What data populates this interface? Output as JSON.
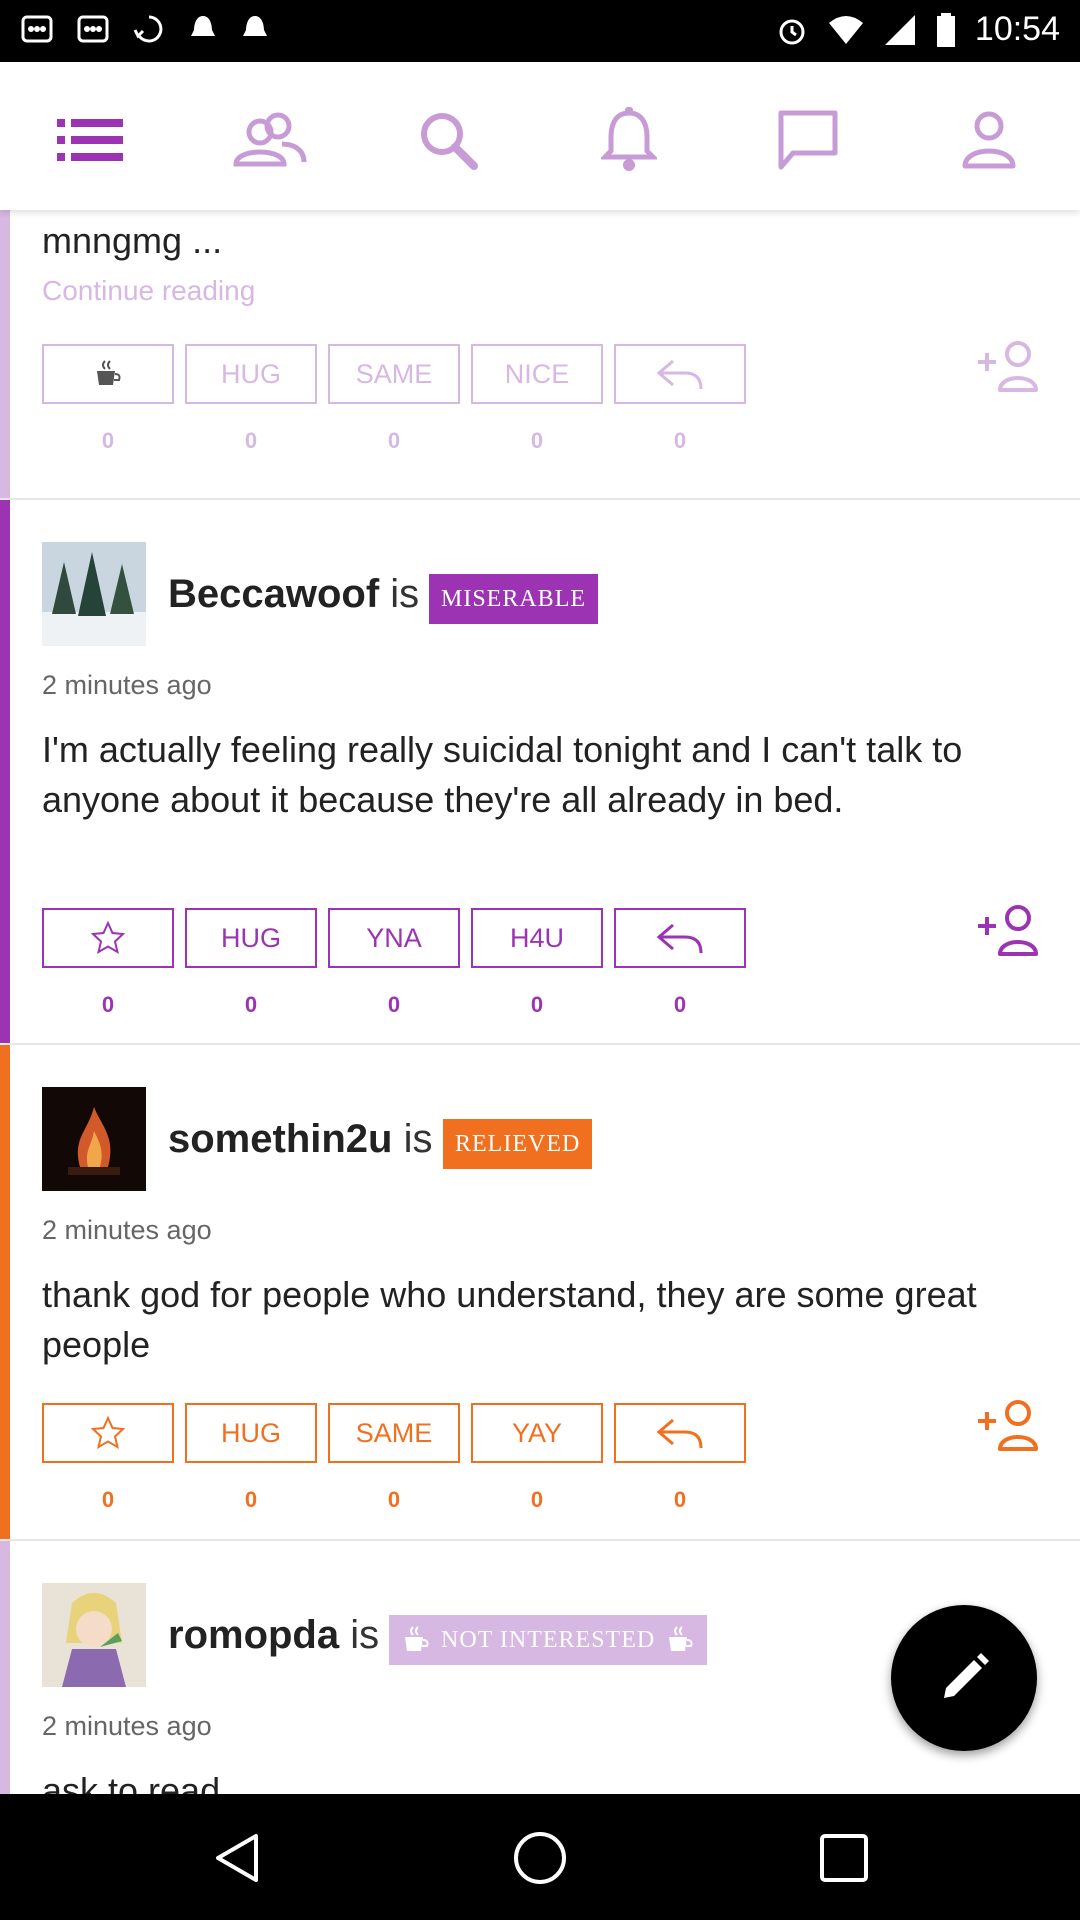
{
  "status_bar": {
    "time": "10:54"
  },
  "top_nav": {
    "items": [
      {
        "icon": "menu-list-icon"
      },
      {
        "icon": "friends-icon"
      },
      {
        "icon": "search-icon"
      },
      {
        "icon": "bell-icon"
      },
      {
        "icon": "chat-icon"
      },
      {
        "icon": "profile-icon"
      }
    ]
  },
  "colors": {
    "purple": "#9c33b3",
    "orange": "#f07020",
    "light_purple": "#c79bd6",
    "pale_purple": "#d7b8e3"
  },
  "post_partial": {
    "text": "mnngmg ...",
    "continue_label": "Continue reading",
    "reactions": [
      {
        "label": "",
        "icon": "coffee-icon",
        "count": "0"
      },
      {
        "label": "HUG",
        "count": "0"
      },
      {
        "label": "SAME",
        "count": "0"
      },
      {
        "label": "NICE",
        "count": "0"
      },
      {
        "label": "",
        "icon": "reply-icon",
        "count": "0"
      }
    ]
  },
  "posts": [
    {
      "username": "Beccawoof",
      "is_word": "is",
      "mood": "MISERABLE",
      "time_ago": "2 minutes ago",
      "text": "I'm actually feeling really suicidal tonight and I can't talk to anyone about it because they're all already in bed.",
      "reactions": [
        {
          "label": "",
          "icon": "star-icon",
          "count": "0"
        },
        {
          "label": "HUG",
          "count": "0"
        },
        {
          "label": "YNA",
          "count": "0"
        },
        {
          "label": "H4U",
          "count": "0"
        },
        {
          "label": "",
          "icon": "reply-icon",
          "count": "0"
        }
      ]
    },
    {
      "username": "somethin2u",
      "is_word": "is",
      "mood": "RELIEVED",
      "time_ago": "2 minutes ago",
      "text": "thank god for people who understand, they are some great people",
      "reactions": [
        {
          "label": "",
          "icon": "star-icon",
          "count": "0"
        },
        {
          "label": "HUG",
          "count": "0"
        },
        {
          "label": "SAME",
          "count": "0"
        },
        {
          "label": "YAY",
          "count": "0"
        },
        {
          "label": "",
          "icon": "reply-icon",
          "count": "0"
        }
      ]
    },
    {
      "username": "romopda",
      "is_word": "is",
      "mood": "NOT INTERESTED",
      "time_ago": "2 minutes ago",
      "text": "ask to read"
    }
  ],
  "fab": {
    "icon": "pencil-icon"
  }
}
